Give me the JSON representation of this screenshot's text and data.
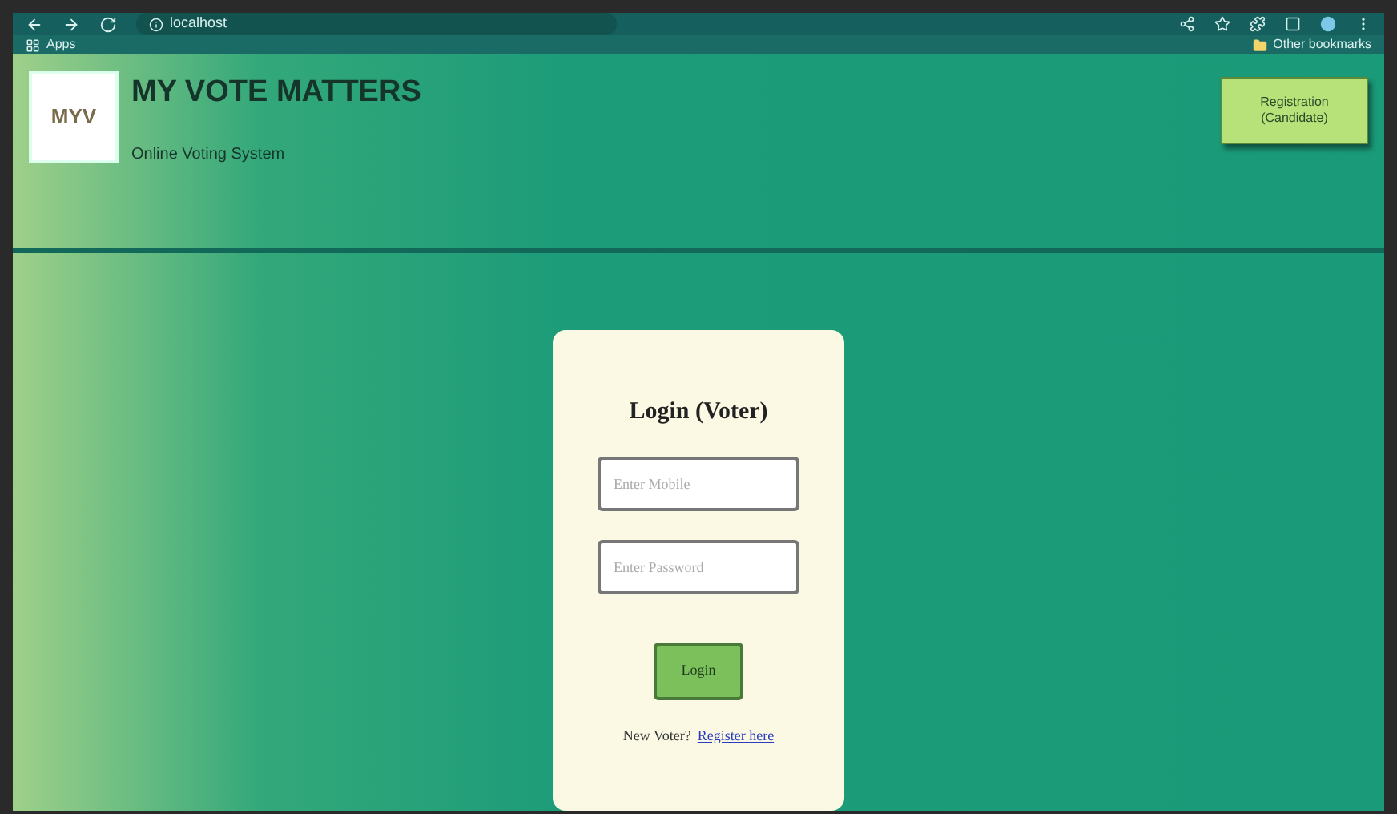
{
  "browser": {
    "url": "localhost",
    "bookmarks": [
      "Apps"
    ],
    "other_bookmarks": "Other bookmarks"
  },
  "header": {
    "logo_text": "MYV",
    "title": "MY VOTE MATTERS",
    "subtitle": "Online Voting System",
    "button": "Registration (Candidate)"
  },
  "login": {
    "title": "Login (Voter)",
    "fields": [
      {
        "placeholder": "Enter Mobile"
      },
      {
        "placeholder": "Enter Password"
      }
    ],
    "button": "Login",
    "prompt": "New Voter?",
    "link": "Register here"
  }
}
